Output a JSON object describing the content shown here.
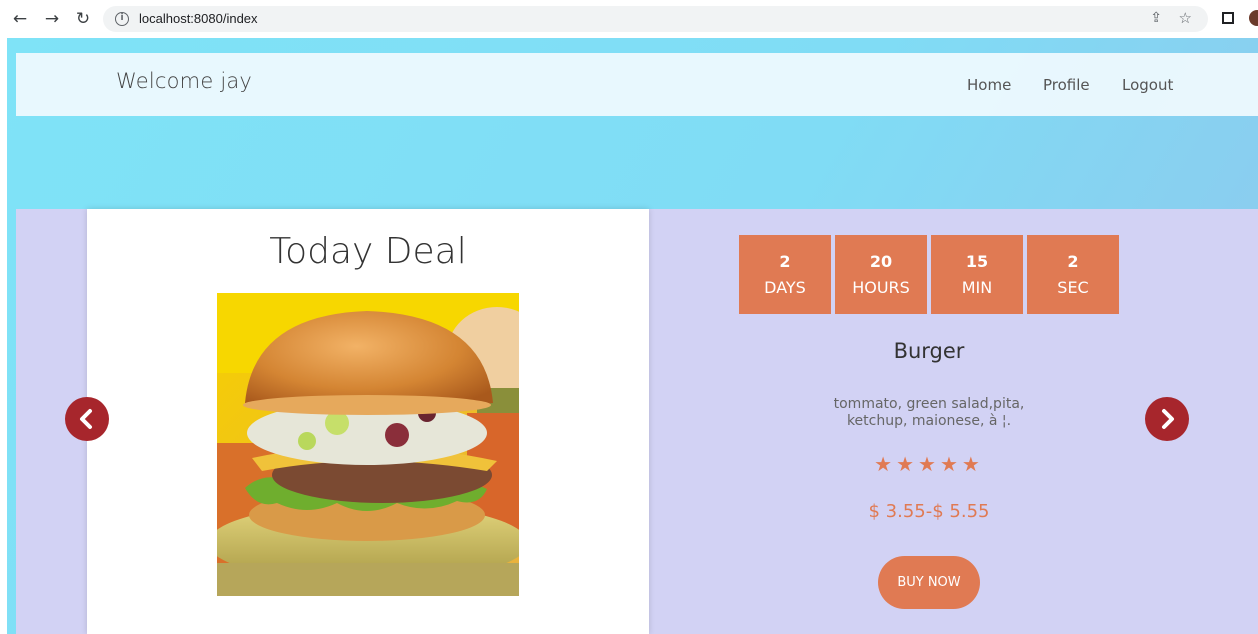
{
  "browser": {
    "url": "localhost:8080/index",
    "icons": {
      "back": "arrow-left-icon",
      "forward": "arrow-right-icon",
      "reload": "reload-icon",
      "info": "info-icon",
      "share": "share-icon",
      "bookmark": "star-icon",
      "window": "window-icon"
    }
  },
  "navbar": {
    "brand": "Welcome jay",
    "links": [
      "Home",
      "Profile",
      "Logout"
    ]
  },
  "deal": {
    "title": "Today Deal",
    "image_alt": "burger",
    "countdown": [
      {
        "value": "2",
        "unit": "DAYS"
      },
      {
        "value": "20",
        "unit": "HOURS"
      },
      {
        "value": "15",
        "unit": "MIN"
      },
      {
        "value": "2",
        "unit": "SEC"
      }
    ],
    "product_name": "Burger",
    "description_line1": "tommato, green salad,pita,",
    "description_line2": "ketchup, maionese, à ¦.",
    "rating": 5,
    "rating_max": 5,
    "price": "$ 3.55-$ 5.55",
    "buy_label": "BUY NOW"
  },
  "carousel": {
    "prev_icon": "chevron-left-icon",
    "next_icon": "chevron-right-icon"
  },
  "colors": {
    "accent": "#e07a53",
    "arrow": "#a7262c",
    "section_bg": "#d2d2f4",
    "page_bg": "#80dcf5"
  }
}
